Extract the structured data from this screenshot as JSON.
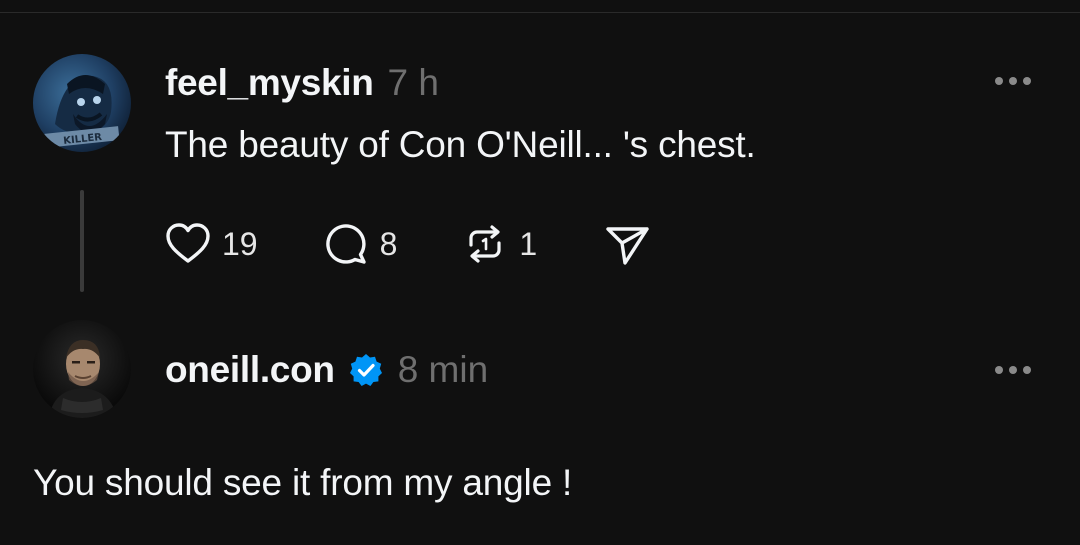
{
  "posts": [
    {
      "username": "feel_myskin",
      "timestamp": "7 h",
      "text": "The beauty of Con O'Neill... 's chest.",
      "verified": false,
      "actions": {
        "likes": "19",
        "replies": "8",
        "reposts": "1"
      },
      "icons": [
        "heart-icon",
        "comment-icon",
        "repost-icon",
        "send-icon",
        "more-icon"
      ]
    },
    {
      "username": "oneill.con",
      "timestamp": "8 min",
      "text": "You should see it from my angle !",
      "verified": true,
      "icons": [
        "verified-badge-icon",
        "more-icon"
      ]
    }
  ],
  "colors": {
    "background": "#101010",
    "text_primary": "#f3f5f7",
    "text_secondary": "#6f6f6f",
    "verified_blue": "#0095f6",
    "thread_line": "#3a3a3a"
  }
}
